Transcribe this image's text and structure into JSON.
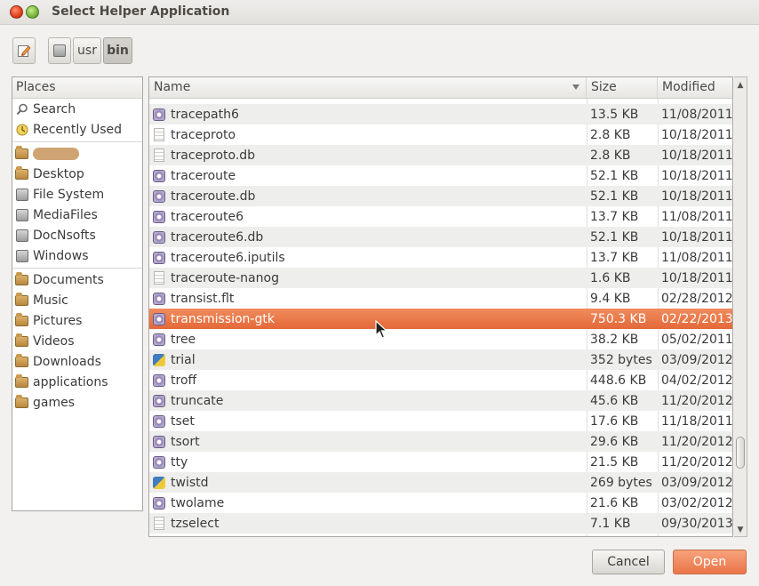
{
  "window": {
    "title": "Select Helper Application"
  },
  "pathbar": {
    "crumbs": [
      {
        "label": ""
      },
      {
        "label": "usr"
      },
      {
        "label": "bin"
      }
    ]
  },
  "places": {
    "header": "Places",
    "groups": [
      [
        {
          "label": "Search",
          "icon": "search-icon"
        },
        {
          "label": "Recently Used",
          "icon": "recent-icon"
        }
      ],
      [
        {
          "label": "",
          "icon": "home-folder-icon"
        },
        {
          "label": "Desktop",
          "icon": "folder-icon"
        },
        {
          "label": "File System",
          "icon": "drive-icon"
        },
        {
          "label": "MediaFiles",
          "icon": "drive-icon"
        },
        {
          "label": "DocNsofts",
          "icon": "drive-icon"
        },
        {
          "label": "Windows",
          "icon": "drive-icon"
        }
      ],
      [
        {
          "label": "Documents",
          "icon": "folder-icon"
        },
        {
          "label": "Music",
          "icon": "folder-icon"
        },
        {
          "label": "Pictures",
          "icon": "folder-icon"
        },
        {
          "label": "Videos",
          "icon": "folder-icon"
        },
        {
          "label": "Downloads",
          "icon": "folder-icon"
        },
        {
          "label": "applications",
          "icon": "folder-icon"
        },
        {
          "label": "games",
          "icon": "folder-icon"
        }
      ]
    ]
  },
  "filelist": {
    "columns": {
      "name": "Name",
      "size": "Size",
      "modified": "Modified"
    },
    "selected_index": 10,
    "rows": [
      {
        "name": "tracepath6",
        "size": "13.5 KB",
        "modified": "11/08/2011",
        "icon": "executable-icon"
      },
      {
        "name": "traceproto",
        "size": "2.8 KB",
        "modified": "10/18/2011",
        "icon": "text-file-icon"
      },
      {
        "name": "traceproto.db",
        "size": "2.8 KB",
        "modified": "10/18/2011",
        "icon": "text-file-icon"
      },
      {
        "name": "traceroute",
        "size": "52.1 KB",
        "modified": "10/18/2011",
        "icon": "executable-icon"
      },
      {
        "name": "traceroute.db",
        "size": "52.1 KB",
        "modified": "10/18/2011",
        "icon": "executable-icon"
      },
      {
        "name": "traceroute6",
        "size": "13.7 KB",
        "modified": "11/08/2011",
        "icon": "executable-icon"
      },
      {
        "name": "traceroute6.db",
        "size": "52.1 KB",
        "modified": "10/18/2011",
        "icon": "executable-icon"
      },
      {
        "name": "traceroute6.iputils",
        "size": "13.7 KB",
        "modified": "11/08/2011",
        "icon": "executable-icon"
      },
      {
        "name": "traceroute-nanog",
        "size": "1.6 KB",
        "modified": "10/18/2011",
        "icon": "text-file-icon"
      },
      {
        "name": "transist.flt",
        "size": "9.4 KB",
        "modified": "02/28/2012",
        "icon": "executable-icon"
      },
      {
        "name": "transmission-gtk",
        "size": "750.3 KB",
        "modified": "02/22/2013",
        "icon": "executable-icon"
      },
      {
        "name": "tree",
        "size": "38.2 KB",
        "modified": "05/02/2011",
        "icon": "executable-icon"
      },
      {
        "name": "trial",
        "size": "352 bytes",
        "modified": "03/09/2012",
        "icon": "python-file-icon"
      },
      {
        "name": "troff",
        "size": "448.6 KB",
        "modified": "04/02/2012",
        "icon": "executable-icon"
      },
      {
        "name": "truncate",
        "size": "45.6 KB",
        "modified": "11/20/2012",
        "icon": "executable-icon"
      },
      {
        "name": "tset",
        "size": "17.6 KB",
        "modified": "11/18/2011",
        "icon": "executable-icon"
      },
      {
        "name": "tsort",
        "size": "29.6 KB",
        "modified": "11/20/2012",
        "icon": "executable-icon"
      },
      {
        "name": "tty",
        "size": "21.5 KB",
        "modified": "11/20/2012",
        "icon": "executable-icon"
      },
      {
        "name": "twistd",
        "size": "269 bytes",
        "modified": "03/09/2012",
        "icon": "python-file-icon"
      },
      {
        "name": "twolame",
        "size": "21.6 KB",
        "modified": "03/02/2012",
        "icon": "executable-icon"
      },
      {
        "name": "tzselect",
        "size": "7.1 KB",
        "modified": "09/30/2013",
        "icon": "text-file-icon"
      }
    ]
  },
  "buttons": {
    "cancel": "Cancel",
    "open": "Open"
  },
  "colors": {
    "selection": "#e9703f",
    "accent_button": "#f08a5d"
  }
}
